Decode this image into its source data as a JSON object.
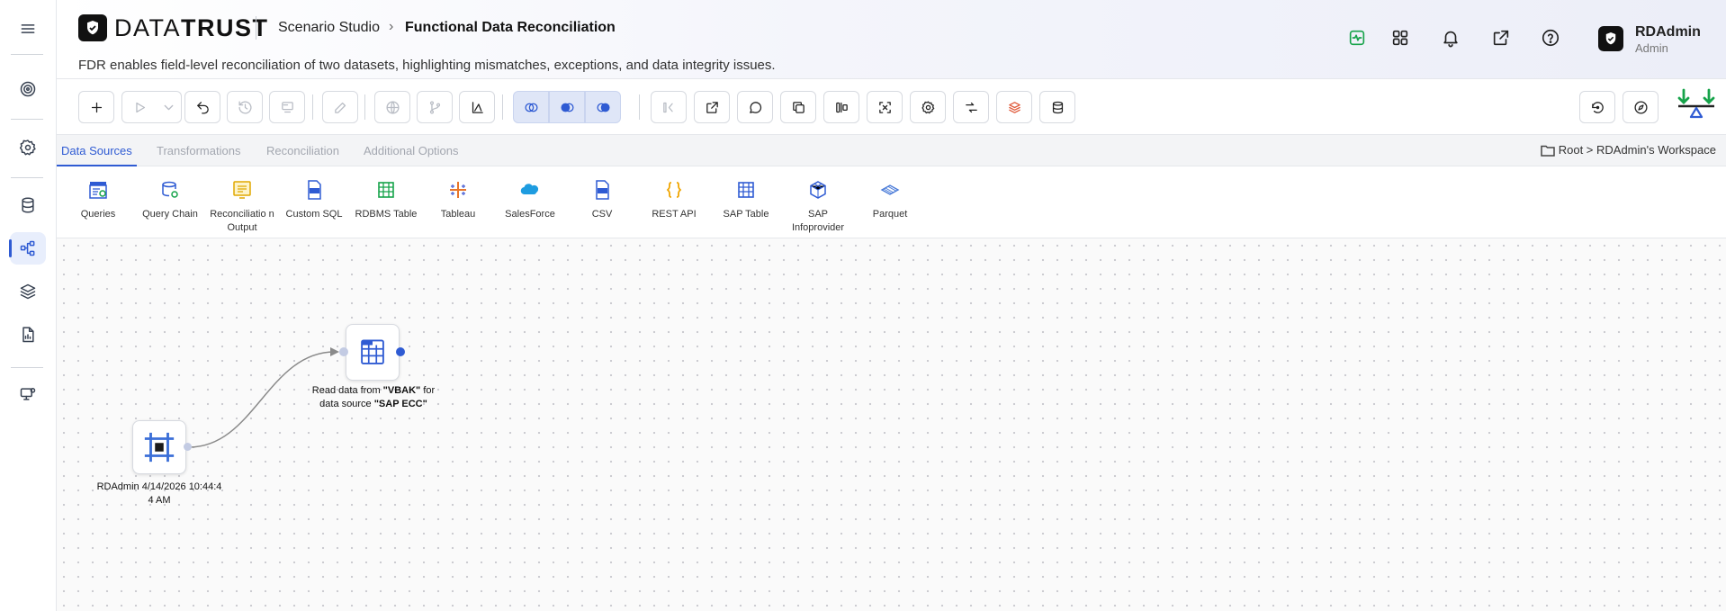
{
  "brand": {
    "logo_text_light": "DATA",
    "logo_text_bold": "TRUST"
  },
  "breadcrumb": {
    "studio": "Scenario Studio",
    "current": "Functional Data Reconciliation"
  },
  "subtitle": "FDR enables field-level reconciliation of two datasets, highlighting mismatches, exceptions, and data integrity issues.",
  "user": {
    "name": "RDAdmin",
    "role": "Admin"
  },
  "header_icons": [
    "activity-icon",
    "apps-grid-icon",
    "bell-icon",
    "external-link-icon",
    "help-icon"
  ],
  "tabs": [
    {
      "label": "Data Sources",
      "active": true
    },
    {
      "label": "Transformations",
      "active": false
    },
    {
      "label": "Reconciliation",
      "active": false
    },
    {
      "label": "Additional Options",
      "active": false
    }
  ],
  "workspace_path": "Root > RDAdmin's Workspace",
  "palette": [
    {
      "label": "Queries"
    },
    {
      "label": "Query Chain"
    },
    {
      "label": "Reconciliatio n Output"
    },
    {
      "label": "Custom SQL"
    },
    {
      "label": "RDBMS Table"
    },
    {
      "label": "Tableau"
    },
    {
      "label": "SalesForce"
    },
    {
      "label": "CSV"
    },
    {
      "label": "REST API"
    },
    {
      "label": "SAP Table"
    },
    {
      "label": "SAP Infoprovider"
    },
    {
      "label": "Parquet"
    }
  ],
  "canvas": {
    "start_node": {
      "label": "RDAdmin 4/14/2026 10:44:4 4 AM"
    },
    "sap_node": {
      "label_prefix": "Read data from ",
      "table": "\"VBAK\"",
      "label_mid": " for data source ",
      "source": "\"SAP ECC\""
    }
  },
  "colors": {
    "accent": "#2f5bd3",
    "active_tab": "#2f5bd3",
    "connector": "#8a8a8a"
  }
}
